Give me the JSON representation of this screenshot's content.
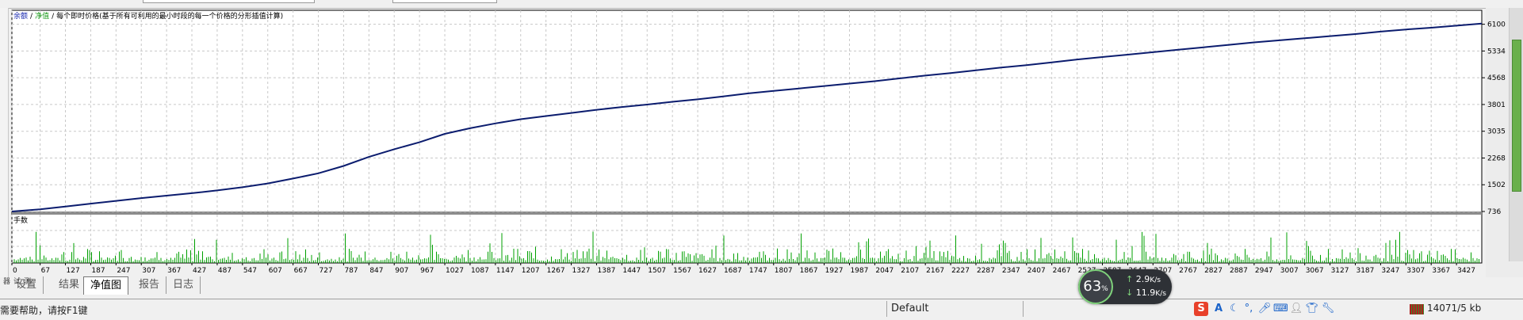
{
  "chart_panel": {
    "legend": {
      "balance": "余额",
      "sep1": "/",
      "equity": "净值",
      "sep2": "/",
      "desc": "每个即时价格(基于所有可利用的最小时段的每一个价格的分形插值计算)"
    },
    "sub_title": "手数"
  },
  "chart_data": {
    "type": "line",
    "x": [
      0,
      67,
      127,
      187,
      247,
      307,
      367,
      427,
      487,
      547,
      607,
      667,
      727,
      787,
      847,
      907,
      967,
      1027,
      1087,
      1147,
      1207,
      1267,
      1327,
      1387,
      1447,
      1507,
      1567,
      1627,
      1687,
      1747,
      1807,
      1867,
      1927,
      1987,
      2047,
      2107,
      2167,
      2227,
      2287,
      2347,
      2407,
      2467,
      2527,
      2587,
      2647,
      2707,
      2767,
      2827,
      2887,
      2947,
      3007,
      3067,
      3127,
      3187,
      3247,
      3307,
      3367,
      3427,
      3487
    ],
    "y_ticks": [
      736,
      1502,
      2268,
      3035,
      3801,
      4568,
      5334,
      6100
    ],
    "ylim": [
      736,
      6500
    ],
    "xlim": [
      0,
      3487
    ],
    "series": [
      {
        "values": [
          736,
          800,
          880,
          960,
          1040,
          1120,
          1190,
          1260,
          1340,
          1430,
          1540,
          1680,
          1830,
          2040,
          2300,
          2520,
          2720,
          2960,
          3120,
          3260,
          3380,
          3470,
          3560,
          3650,
          3730,
          3800,
          3880,
          3950,
          4030,
          4120,
          4190,
          4260,
          4330,
          4400,
          4470,
          4550,
          4630,
          4700,
          4780,
          4860,
          4930,
          5010,
          5090,
          5160,
          5230,
          5300,
          5370,
          5440,
          5510,
          5580,
          5640,
          5700,
          5760,
          5820,
          5890,
          5950,
          6000,
          6060,
          6120
        ]
      }
    ],
    "x_tick_labels": [
      "0",
      "67",
      "127",
      "187",
      "247",
      "307",
      "367",
      "427",
      "487",
      "547",
      "607",
      "667",
      "727",
      "787",
      "847",
      "907",
      "967",
      "1027",
      "1087",
      "1147",
      "1207",
      "1267",
      "1327",
      "1387",
      "1447",
      "1507",
      "1567",
      "1627",
      "1687",
      "1747",
      "1807",
      "1867",
      "1927",
      "1987",
      "2047",
      "2107",
      "2167",
      "2227",
      "2287",
      "2347",
      "2407",
      "2467",
      "2527",
      "2587",
      "2647",
      "2707",
      "2767",
      "2827",
      "2887",
      "2947",
      "3007",
      "3067",
      "3127",
      "3187",
      "3247",
      "3307",
      "3367",
      "3427"
    ],
    "grid": true,
    "colors": {
      "line": "#0b1c6e",
      "volume": "#00a000",
      "grid": "#c8c8c8",
      "axis": "#000000"
    }
  },
  "tabs": [
    {
      "label": "设置"
    },
    {
      "label": "结果"
    },
    {
      "label": "净值图",
      "active": true
    },
    {
      "label": "报告"
    },
    {
      "label": "日志"
    }
  ],
  "statusbar": {
    "help": "需要帮助，请按F1键",
    "profile": "Default",
    "traffic": "14071/5 kb"
  },
  "net_monitor": {
    "percent": "63",
    "unit": "%",
    "up": "2.9",
    "up_unit": "K/s",
    "down": "11.9",
    "down_unit": "K/s"
  },
  "ime_toolbar": {
    "icons": [
      "sogou-logo-icon",
      "font-icon",
      "moon-icon",
      "punctuation-icon",
      "microphone-icon",
      "keyboard-icon",
      "user-icon",
      "shirt-icon",
      "wrench-icon"
    ],
    "font_glyph": "A"
  }
}
